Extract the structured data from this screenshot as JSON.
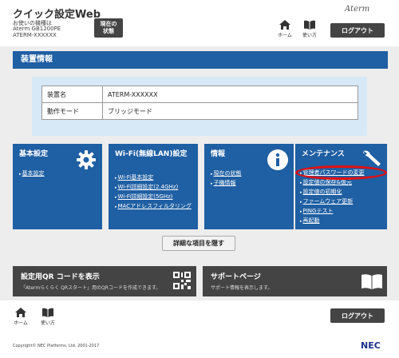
{
  "header": {
    "app_title": "クイック設定Web",
    "device_label": "お使いの機種は",
    "device_model": "Aterm GB1200PE",
    "device_name": "ATERM-XXXXXX",
    "status_button": "現在の\n状態",
    "brand": "Aterm",
    "home_label": "ホーム",
    "help_label": "使い方",
    "logout": "ログアウト"
  },
  "device_info": {
    "title": "装置情報",
    "rows": [
      {
        "key": "装置名",
        "value": "ATERM-XXXXXX"
      },
      {
        "key": "動作モード",
        "value": "ブリッジモード"
      }
    ]
  },
  "cards": {
    "basic": {
      "title": "基本設定",
      "icon": "gear-icon",
      "links": [
        "基本設定"
      ]
    },
    "wifi": {
      "title": "Wi-Fi(無線LAN)設定",
      "icon": "wifi-icon",
      "links": [
        "Wi-Fi基本設定",
        "Wi-Fi詳細設定(2.4GHz)",
        "Wi-Fi詳細設定(5GHz)",
        "MACアドレスフィルタリング"
      ]
    },
    "info": {
      "title": "情報",
      "icon": "info-icon",
      "links": [
        "現在の状態",
        "子機情報"
      ]
    },
    "maint": {
      "title": "メンテナンス",
      "icon": "wrench-icon",
      "links": [
        "管理者パスワードの変更",
        "設定値の保存&復元",
        "設定値の初期化",
        "ファームウェア更新",
        "PINGテスト",
        "再起動"
      ]
    }
  },
  "hide_details": "詳細な項目を隠す",
  "qr_panel": {
    "title": "設定用QR コードを表示",
    "desc": "「Atermらくらく QRスタート」用のQRコードを作成できます。"
  },
  "support_panel": {
    "title": "サポートページ",
    "desc": "サポート情報を表示します。"
  },
  "footer": {
    "home_label": "ホーム",
    "help_label": "使い方",
    "logout": "ログアウト",
    "copyright": "Copyright© NEC Platforms, Ltd. 2001-2017",
    "logo": "NEC"
  },
  "colors": {
    "primary": "#1f5fa3",
    "dark": "#444444",
    "highlight": "#e01010",
    "info_bg": "#d7e8f6"
  }
}
